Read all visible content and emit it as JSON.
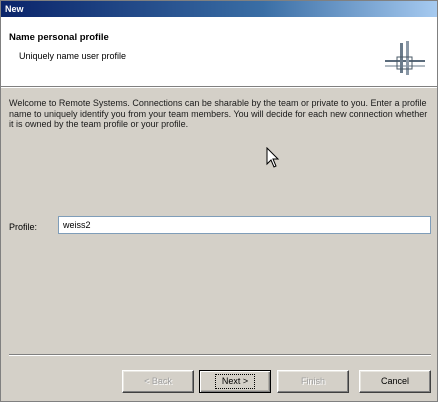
{
  "window": {
    "title": "New"
  },
  "banner": {
    "title": "Name personal profile",
    "description": "Uniquely name user profile",
    "graphic_icon": "network-connection-icon"
  },
  "intro": {
    "text": "Welcome to Remote Systems. Connections can be sharable by the team or private to you. Enter a profile name to uniquely identify you from your team members. You will decide for each new connection whether it is owned by the team profile or your profile."
  },
  "form": {
    "profile_label": "Profile:",
    "profile_value": "weiss2"
  },
  "buttons": {
    "back": "< Back",
    "next": "Next >",
    "finish": "Finish",
    "cancel": "Cancel"
  }
}
